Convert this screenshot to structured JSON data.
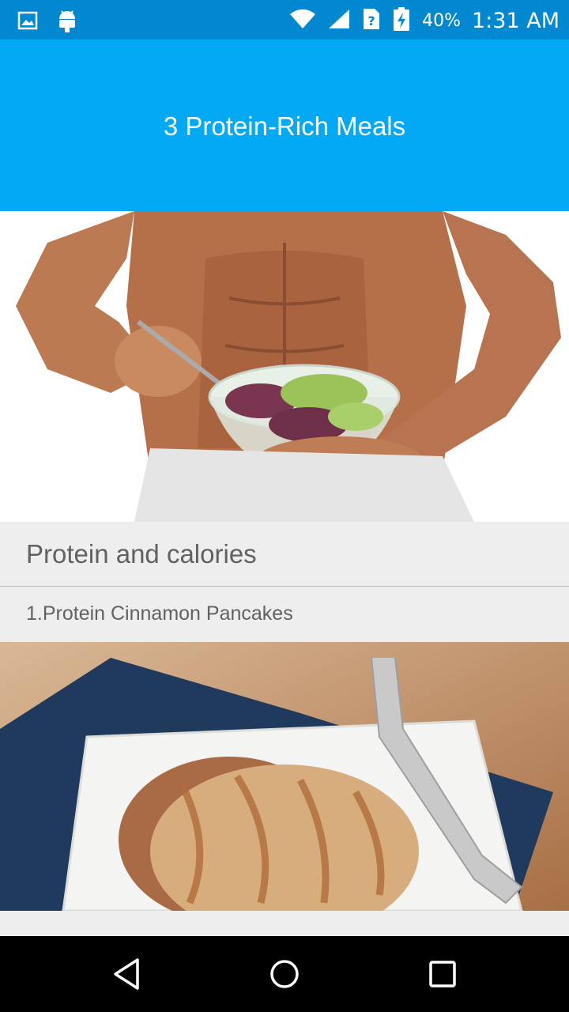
{
  "status_bar": {
    "battery_percent": "40%",
    "time": "1:31 AM",
    "icons": [
      "image-icon",
      "android-icon",
      "wifi-icon",
      "signal-icon",
      "sim-unknown-icon",
      "battery-charging-icon"
    ]
  },
  "app_bar": {
    "title": "3 Protein-Rich Meals"
  },
  "content": {
    "hero_image": "man-eating-salad-image",
    "section_title": "Protein and calories",
    "items": [
      {
        "label": "1.Protein Cinnamon Pancakes",
        "image": "cinnamon-pancakes-image"
      }
    ]
  },
  "nav_bar": {
    "buttons": [
      "back-icon",
      "home-icon",
      "recents-icon"
    ]
  },
  "colors": {
    "status_bar": "#0288d1",
    "app_bar": "#03a9f4",
    "background": "#eeeeee",
    "text_secondary": "#616161"
  }
}
